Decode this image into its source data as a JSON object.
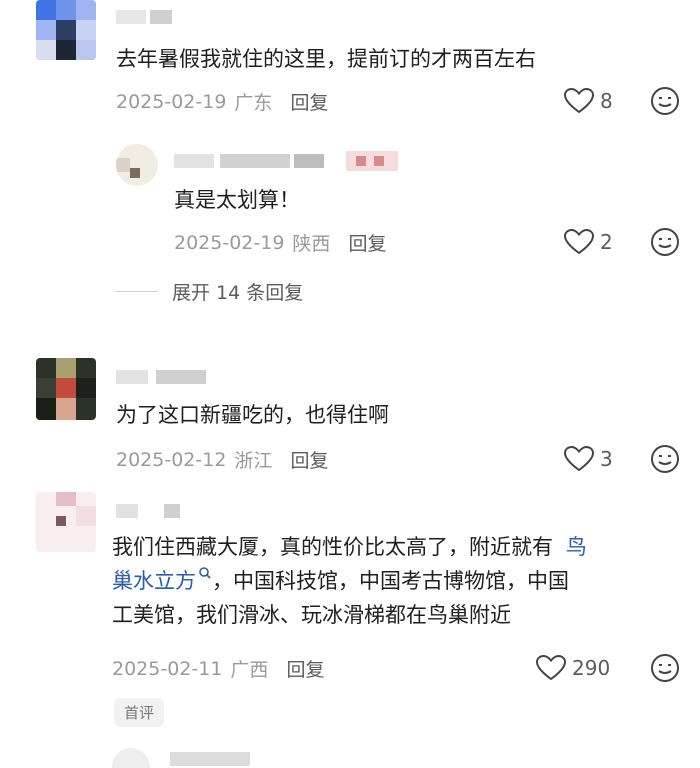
{
  "comments": [
    {
      "text": "去年暑假我就住的这里，提前订的才两百左右",
      "date": "2025-02-19",
      "region": "广东",
      "reply_label": "回复",
      "likes": "8",
      "replies": [
        {
          "text": "真是太划算！",
          "date": "2025-02-19",
          "region": "陕西",
          "reply_label": "回复",
          "likes": "2"
        }
      ],
      "expand_label": "展开 14 条回复"
    },
    {
      "text": "为了这口新疆吃的，也得住啊",
      "date": "2025-02-12",
      "region": "浙江",
      "reply_label": "回复",
      "likes": "3"
    },
    {
      "text_line1": "我们住西藏大厦，真的性价比太高了，附近就有",
      "link_part1": "鸟",
      "link_part2": "巢水立方",
      "text_line2_rest": "，中国科技馆，中国考古博物馆，中国",
      "text_line3": "工美馆，我们滑冰、玩冰滑梯都在鸟巢附近",
      "date": "2025-02-11",
      "region": "广西",
      "reply_label": "回复",
      "likes": "290",
      "tag": "首评"
    }
  ],
  "colors": {
    "text": "#1f1f1f",
    "meta": "#9a9a9a",
    "link": "#2b5dab"
  },
  "icons": [
    "heart-icon",
    "emoji-icon",
    "search-icon"
  ]
}
